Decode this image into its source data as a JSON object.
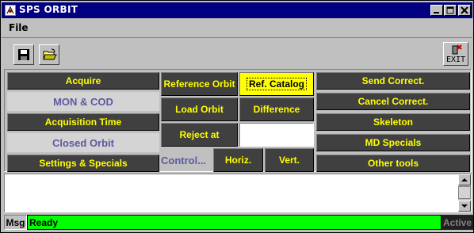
{
  "window": {
    "title": "SPS ORBIT",
    "controls": [
      "minimize-icon",
      "maximize-icon",
      "close-icon"
    ]
  },
  "menu": {
    "file": "File"
  },
  "toolbar": {
    "save_icon": "floppy-disk-icon",
    "open_icon": "open-folder-icon",
    "exit_label": "EXIT"
  },
  "panel": {
    "left": {
      "acquire": "Acquire",
      "mon_cod": "MON & COD",
      "acquisition_time": "Acquisition Time",
      "closed_orbit": "Closed Orbit",
      "settings_specials": "Settings & Specials"
    },
    "middle": {
      "reference_orbit": "Reference Orbit",
      "ref_catalog": "Ref. Catalog",
      "load_orbit": "Load Orbit",
      "difference": "Difference",
      "reject_at": "Reject at",
      "reject_value": "",
      "control": "Control...",
      "horiz": "Horiz.",
      "vert": "Vert."
    },
    "right": {
      "send_correct": "Send Correct.",
      "cancel_correct": "Cancel Correct.",
      "skeleton": "Skeleton",
      "md_specials": "MD Specials",
      "other_tools": "Other tools"
    }
  },
  "messages": {
    "text": ""
  },
  "status": {
    "msg_label": "Msg",
    "text": "Ready",
    "state": "Active",
    "color": "#00ff00"
  },
  "colors": {
    "button_bg": "#404040",
    "button_text": "#ffff00",
    "label_text": "#5a5aa0",
    "titlebar": "#000080"
  }
}
